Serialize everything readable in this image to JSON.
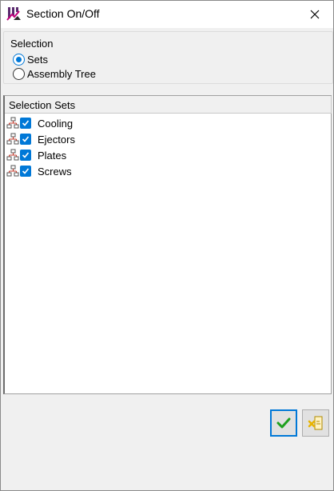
{
  "window": {
    "title": "Section On/Off",
    "close_icon": "close-icon",
    "app_icon": "section-app-icon"
  },
  "selection": {
    "legend": "Selection",
    "options": [
      {
        "label": "Sets",
        "checked": true
      },
      {
        "label": "Assembly Tree",
        "checked": false
      }
    ]
  },
  "list": {
    "header": "Selection Sets",
    "items": [
      {
        "label": "Cooling",
        "checked": true,
        "icon": "tree-node-icon"
      },
      {
        "label": "Ejectors",
        "checked": true,
        "icon": "tree-node-icon"
      },
      {
        "label": "Plates",
        "checked": true,
        "icon": "tree-node-icon"
      },
      {
        "label": "Screws",
        "checked": true,
        "icon": "tree-node-icon"
      }
    ]
  },
  "buttons": {
    "ok_icon": "checkmark-icon",
    "cancel_icon": "cancel-icon"
  },
  "colors": {
    "accent": "#0078d7",
    "ok_green": "#1ea01e",
    "cancel_yellow": "#e8b400"
  }
}
